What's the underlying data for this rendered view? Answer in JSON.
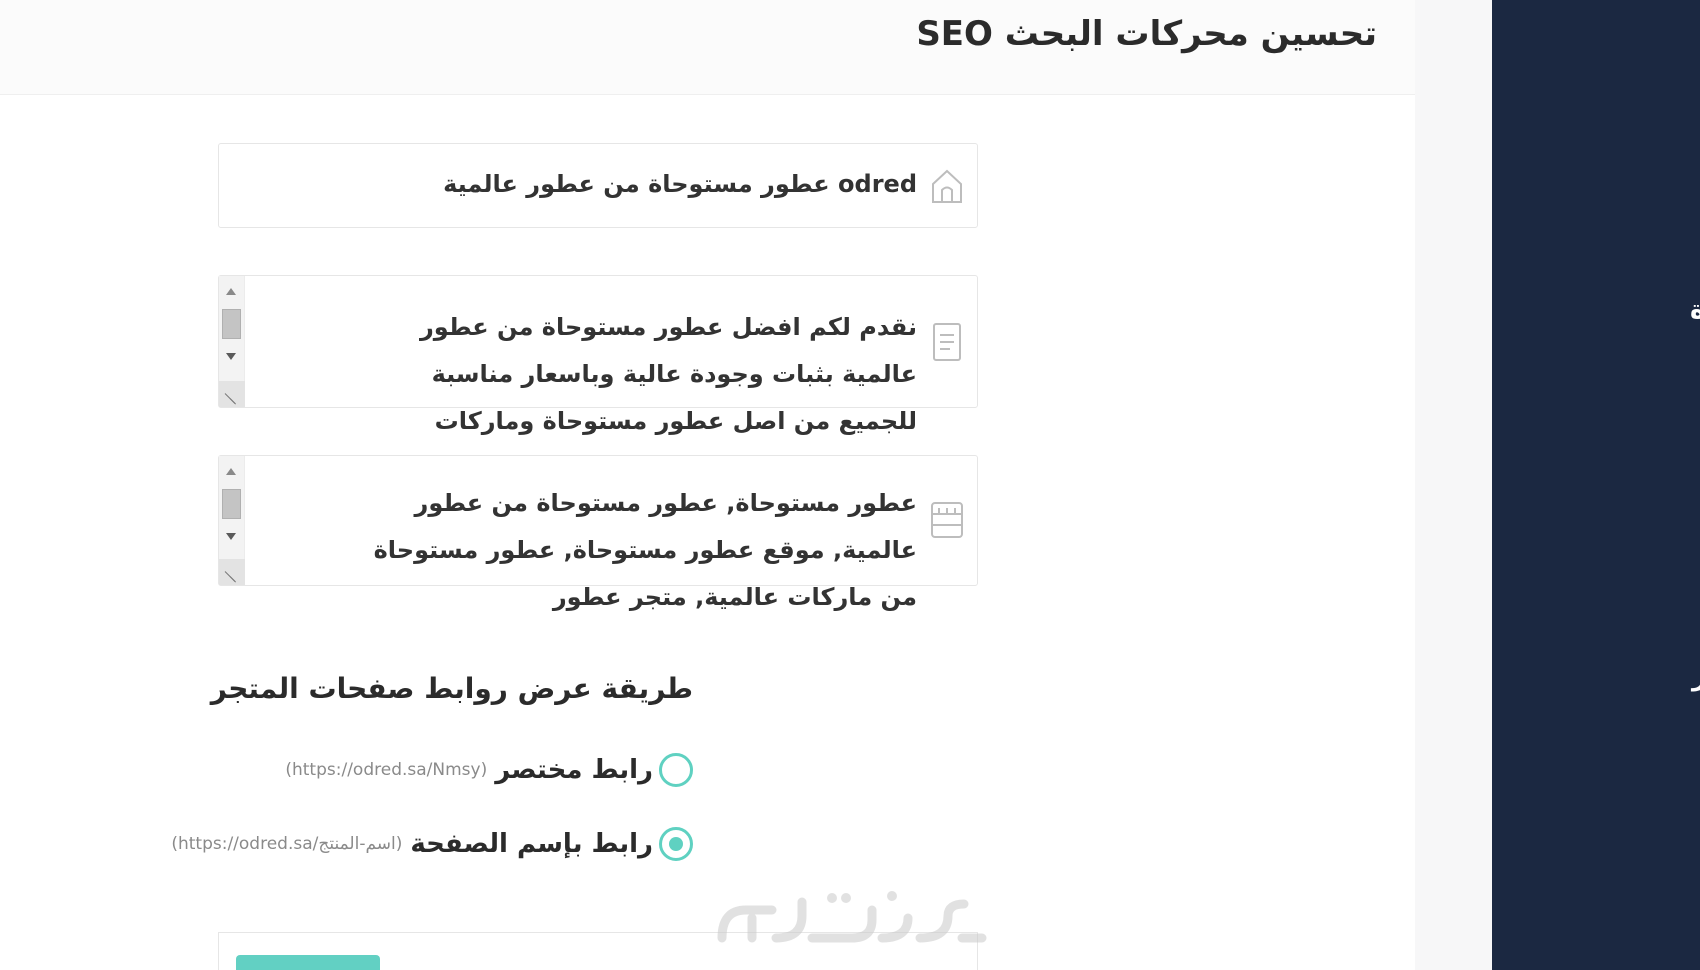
{
  "header": {
    "title": "تحسين محركات البحث SEO"
  },
  "seo": {
    "page_title_value": "odred عطور مستوحاة من عطور عالمية",
    "description_value": "نقدم لكم افضل عطور مستوحاة من عطور عالمية بثبات وجودة عالية وباسعار مناسبة للجميع من اصل عطور مستوحاة وماركات",
    "keywords_value": "عطور مستوحاة, عطور مستوحاة من عطور عالمية, موقع عطور مستوحاة, عطور مستوحاة من ماركات عالمية, متجر عطور"
  },
  "links": {
    "heading": "طريقة عرض روابط صفحات المتجر",
    "options": [
      {
        "label": "رابط مختصر",
        "hint": "(https://odred.sa/Nmsy)",
        "selected": false
      },
      {
        "label": "رابط بإسم الصفحة",
        "hint": "(https://odred.sa/اسم-المنتج)",
        "selected": true
      }
    ]
  },
  "sidebar": {
    "fragment_1": "ة",
    "fragment_2": "ر"
  },
  "watermark": {
    "text": "خمسات"
  },
  "colors": {
    "sidebar_bg": "#1b2841",
    "accent": "#5fd1c1"
  },
  "icons": {
    "title_field": "home-icon",
    "description_field": "document-icon",
    "keywords_field": "tag-list-icon"
  }
}
